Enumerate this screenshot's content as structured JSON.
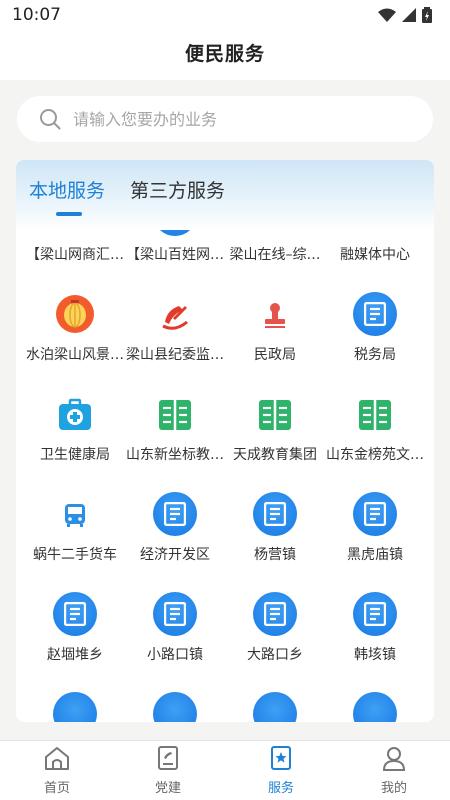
{
  "status": {
    "time": "10:07"
  },
  "header": {
    "title": "便民服务"
  },
  "search": {
    "placeholder": "请输入您要办的业务"
  },
  "tabs": {
    "local": "本地服务",
    "third_party": "第三方服务"
  },
  "services": [
    {
      "label": "【梁山网商汇…",
      "icon": "globe-icon"
    },
    {
      "label": "【梁山百姓网…",
      "icon": "document-icon"
    },
    {
      "label": "梁山在线–综…",
      "icon": "building-icon"
    },
    {
      "label": "融媒体中心",
      "icon": "media-icon"
    },
    {
      "label": "水泊梁山风景…",
      "icon": "lantern-icon"
    },
    {
      "label": "梁山县纪委监…",
      "icon": "party-emblem-icon"
    },
    {
      "label": "民政局",
      "icon": "stamp-icon"
    },
    {
      "label": "税务局",
      "icon": "document-icon"
    },
    {
      "label": "卫生健康局",
      "icon": "medical-kit-icon"
    },
    {
      "label": "山东新坐标教…",
      "icon": "book-icon"
    },
    {
      "label": "天成教育集团",
      "icon": "book-icon"
    },
    {
      "label": "山东金榜苑文…",
      "icon": "book-icon"
    },
    {
      "label": "蜗牛二手货车",
      "icon": "bus-icon"
    },
    {
      "label": "经济开发区",
      "icon": "document-icon"
    },
    {
      "label": "杨营镇",
      "icon": "document-icon"
    },
    {
      "label": "黑虎庙镇",
      "icon": "document-icon"
    },
    {
      "label": "赵堌堆乡",
      "icon": "document-icon"
    },
    {
      "label": "小路口镇",
      "icon": "document-icon"
    },
    {
      "label": "大路口乡",
      "icon": "document-icon"
    },
    {
      "label": "韩垓镇",
      "icon": "document-icon"
    },
    {
      "label": "",
      "icon": "document-icon"
    },
    {
      "label": "",
      "icon": "document-icon"
    },
    {
      "label": "",
      "icon": "document-icon"
    },
    {
      "label": "",
      "icon": "document-icon"
    }
  ],
  "bottom_nav": {
    "home": "首页",
    "party": "党建",
    "service": "服务",
    "mine": "我的"
  },
  "colors": {
    "accent": "#1f80d6",
    "icon_blue": "#1577e3",
    "green": "#2fb36a",
    "red": "#e43a2a"
  }
}
